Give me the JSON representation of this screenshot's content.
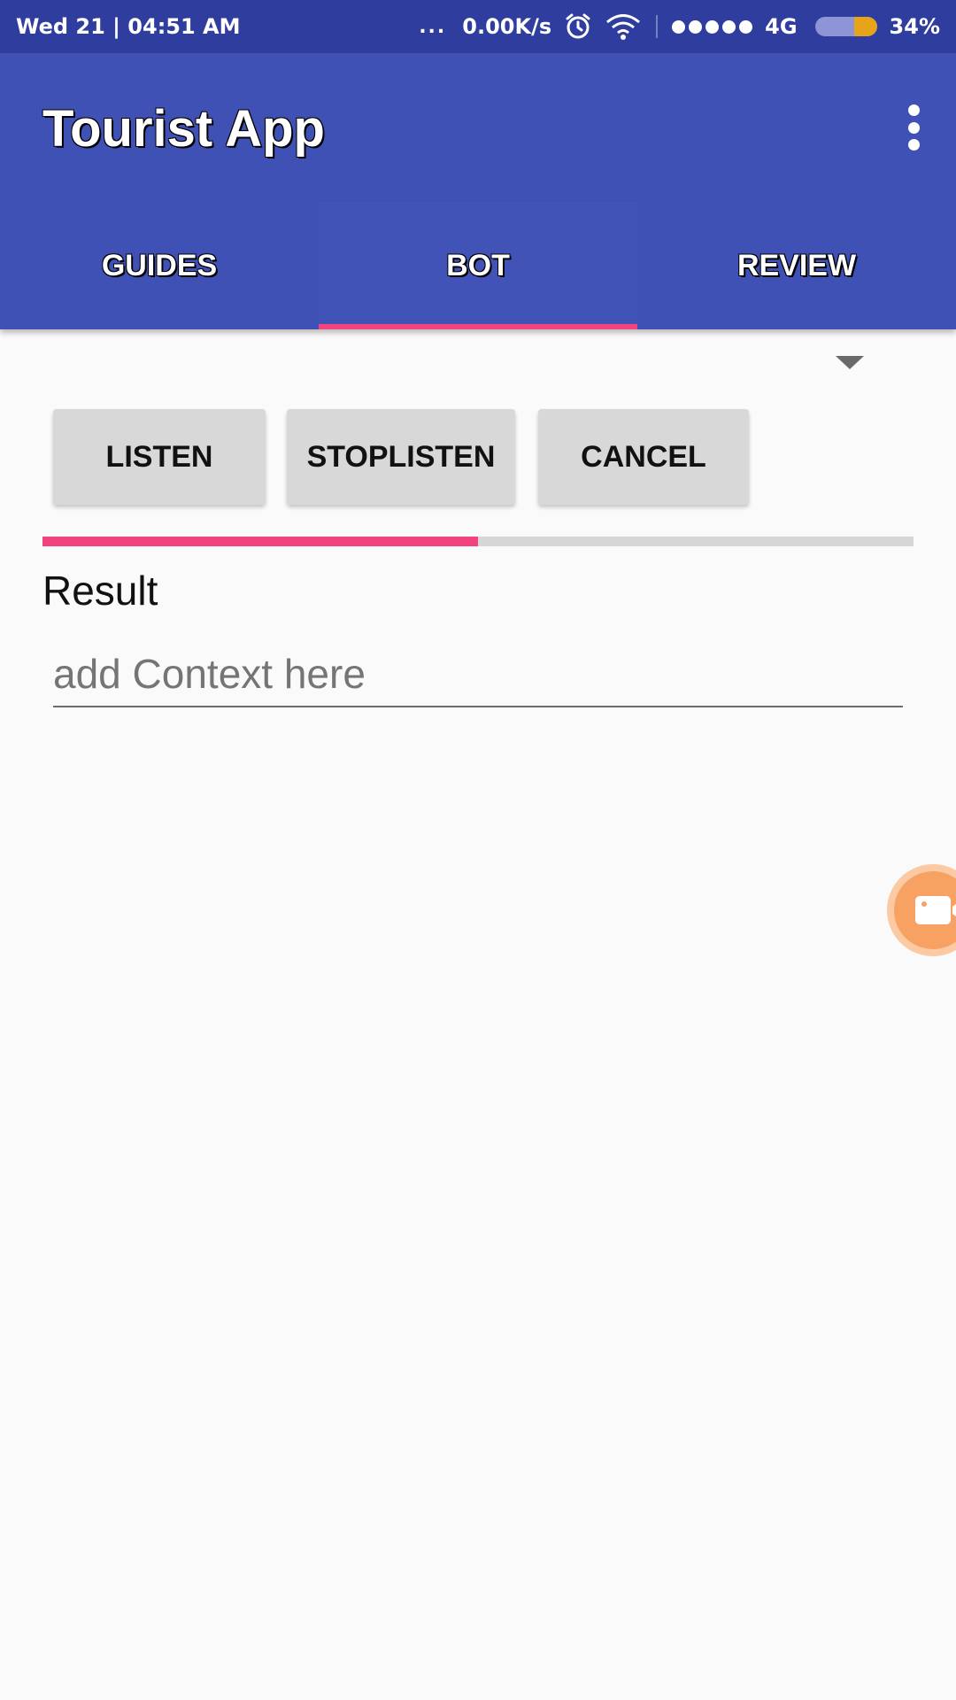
{
  "status_bar": {
    "datetime": "Wed 21 | 04:51 AM",
    "more_dots": "...",
    "net_speed": "0.00K/s",
    "network_type": "4G",
    "battery": "34%",
    "battery_level_fraction": 0.34,
    "icons": [
      "alarm-icon",
      "wifi-icon",
      "signal-icon",
      "battery-icon"
    ]
  },
  "app_bar": {
    "title": "Tourist App",
    "overflow_icon": "more-vert-icon"
  },
  "tabs": [
    {
      "label": "GUIDES",
      "active": false
    },
    {
      "label": "BOT",
      "active": true
    },
    {
      "label": "REVIEW",
      "active": false
    }
  ],
  "bot": {
    "dropdown_icon": "arrow-drop-down-icon",
    "buttons": {
      "listen": "LISTEN",
      "stop_listen": "STOPLISTEN",
      "cancel": "CANCEL"
    },
    "progress_fraction": 0.5,
    "result_label": "Result",
    "context_input": {
      "value": "",
      "placeholder": "add Context here"
    }
  },
  "floating_button": {
    "icon": "video-camera-icon"
  },
  "colors": {
    "status_bar": "#2f3d9e",
    "primary": "#3f51b5",
    "accent": "#f3437f",
    "button": "#d8d8d8",
    "floating": "#f7a263"
  }
}
